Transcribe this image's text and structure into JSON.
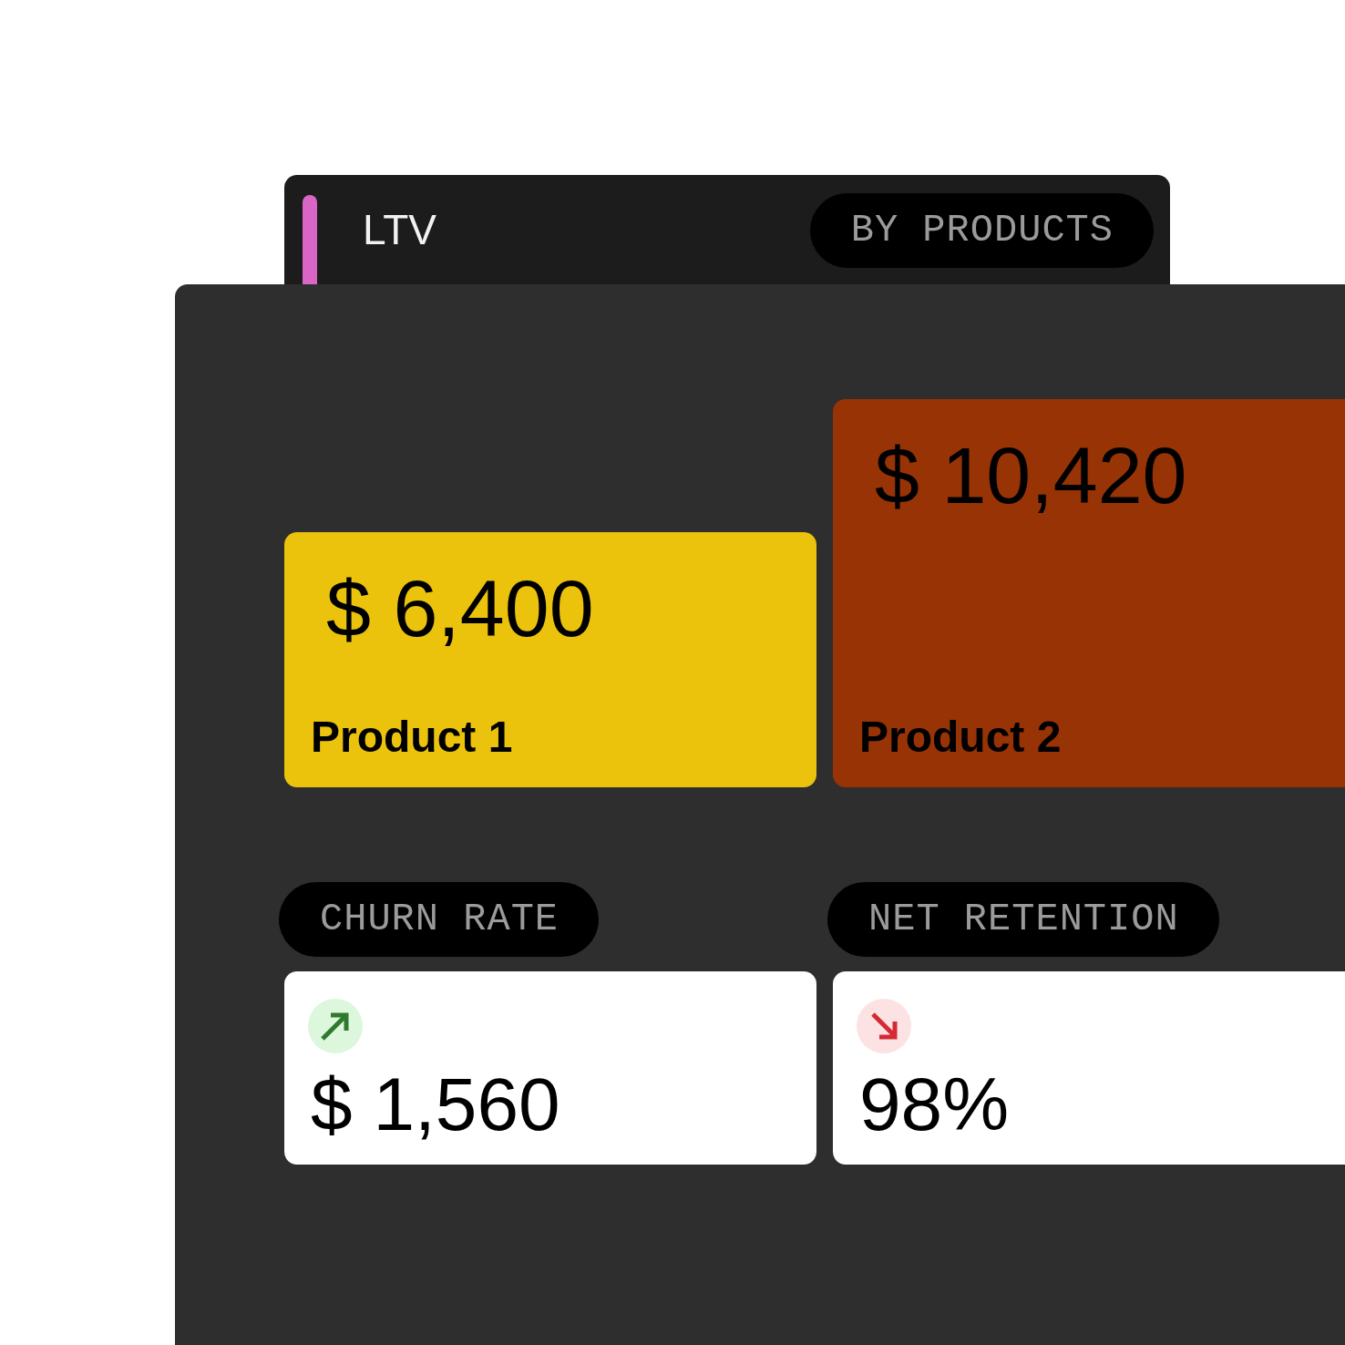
{
  "header": {
    "title": "LTV",
    "filter": "BY PRODUCTS"
  },
  "products": [
    {
      "value": "$ 6,400",
      "label": "Product 1",
      "color": "#ecc30c"
    },
    {
      "value": "$ 10,420",
      "label": "Product 2",
      "color": "#983306"
    }
  ],
  "metrics": [
    {
      "label": "CHURN RATE",
      "kind": "up",
      "value": "$ 1,560"
    },
    {
      "label": "NET RETENTION",
      "kind": "down",
      "value": "98%"
    }
  ]
}
